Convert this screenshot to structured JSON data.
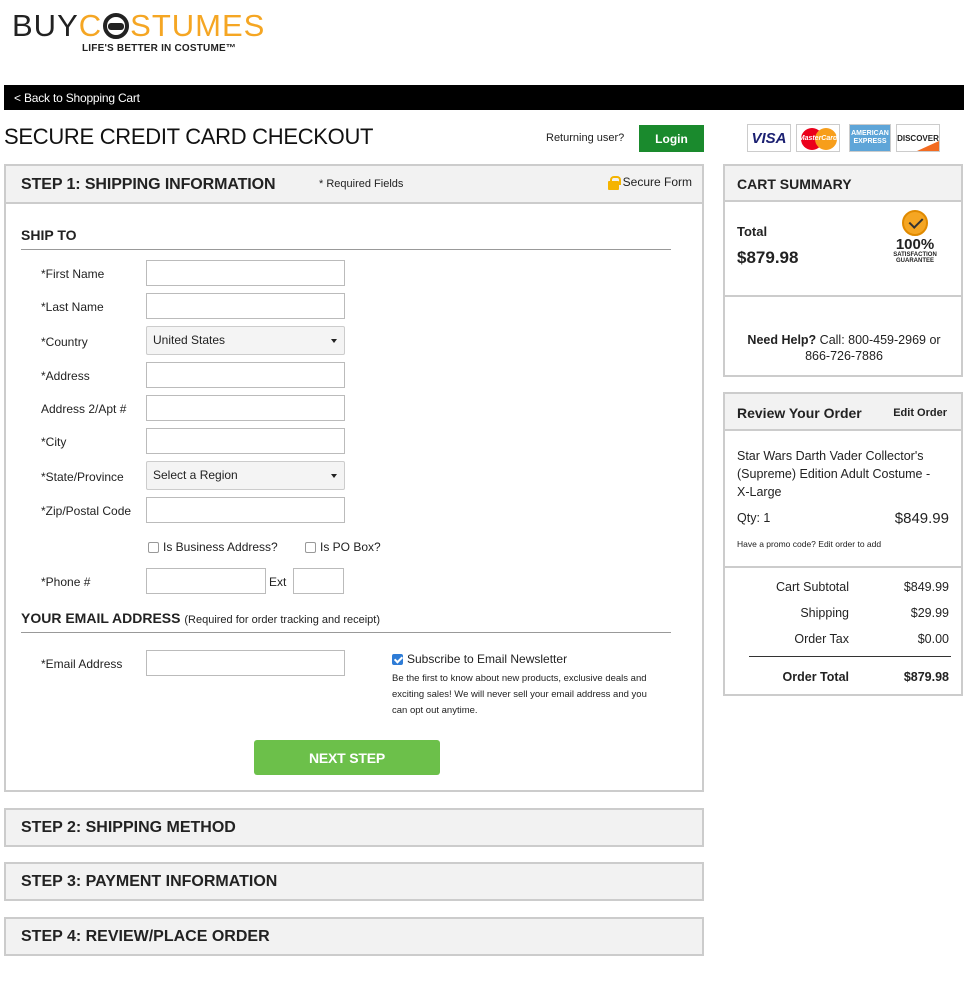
{
  "brand": {
    "logo_prefix": "BUY",
    "logo_suffix": "STUMES",
    "tagline": "LIFE'S BETTER IN COSTUME™"
  },
  "nav": {
    "back_link": "< Back to Shopping Cart"
  },
  "header": {
    "title": "SECURE CREDIT CARD CHECKOUT",
    "returning_user": "Returning user?",
    "login_label": "Login",
    "cards": {
      "visa": "VISA",
      "mastercard": "MasterCard",
      "amex": "AMERICAN EXPRESS",
      "discover": "DISCOVER"
    }
  },
  "step1": {
    "title": "STEP 1: SHIPPING INFORMATION",
    "required_note": "* Required Fields",
    "secure_label": "Secure Form",
    "ship_to": "SHIP TO",
    "fields": {
      "first_name": "*First Name",
      "last_name": "*Last Name",
      "country": "*Country",
      "country_value": "United States",
      "address": "*Address",
      "address2": "Address 2/Apt #",
      "city": "*City",
      "state": "*State/Province",
      "state_value": "Select a Region",
      "zip": "*Zip/Postal Code",
      "business": "Is Business Address?",
      "po_box": "Is PO Box?",
      "phone": "*Phone #",
      "ext": "Ext"
    },
    "email_section": "YOUR EMAIL ADDRESS",
    "email_section_sub": "(Required for order tracking and receipt)",
    "email_label": "*Email Address",
    "newsletter_label": "Subscribe to Email Newsletter",
    "newsletter_checked": true,
    "newsletter_text": "Be the first to know about new products, exclusive deals and exciting sales! We will never sell your email address and you can opt out anytime.",
    "next_label": "NEXT STEP"
  },
  "steps": {
    "step2": "STEP 2: SHIPPING METHOD",
    "step3": "STEP 3: PAYMENT INFORMATION",
    "step4": "STEP 4: REVIEW/PLACE ORDER"
  },
  "cart_summary": {
    "title": "CART SUMMARY",
    "total_label": "Total",
    "total_value": "$879.98",
    "guarantee_pct": "100%",
    "guarantee_text": "SATISFACTION GUARANTEE",
    "help_bold": "Need Help?",
    "help_text": " Call: 800-459-2969 or 866-726-7886"
  },
  "review": {
    "title": "Review Your Order",
    "edit_label": "Edit Order",
    "item_name": "Star Wars Darth Vader Collector's (Supreme) Edition Adult Costume - X-Large",
    "qty": "Qty: 1",
    "item_price": "$849.99",
    "promo": "Have a promo code? Edit order to add",
    "subtotal_label": "Cart Subtotal",
    "subtotal_value": "$849.99",
    "shipping_label": "Shipping",
    "shipping_value": "$29.99",
    "tax_label": "Order Tax",
    "tax_value": "$0.00",
    "order_total_label": "Order Total",
    "order_total_value": "$879.98"
  }
}
